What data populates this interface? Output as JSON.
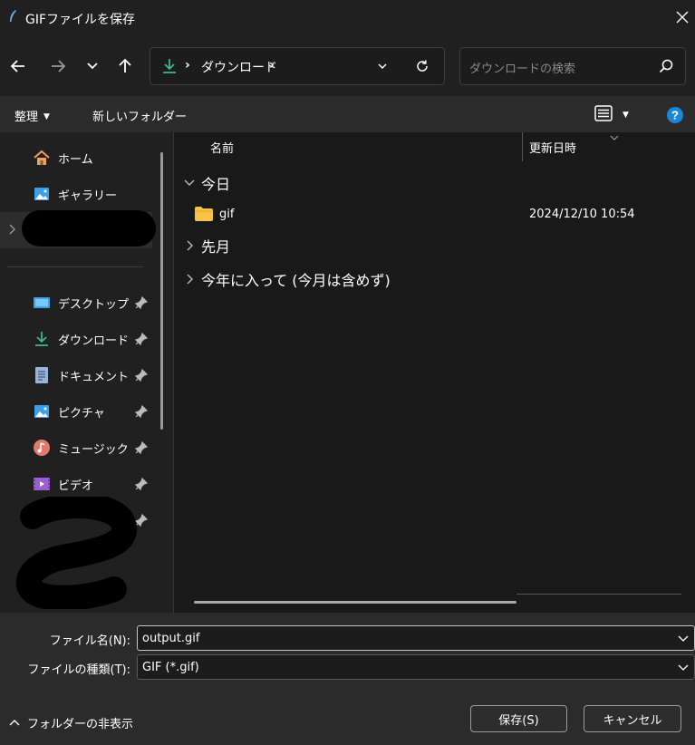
{
  "window": {
    "title": "GIFファイルを保存",
    "close_icon": "close-icon",
    "app_icon": "quill-icon"
  },
  "nav": {
    "back_icon": "arrow-left-icon",
    "forward_icon": "arrow-right-icon",
    "recent_icon": "chevron-down-icon",
    "up_icon": "arrow-up-icon",
    "address": {
      "separator": "›",
      "crumb": "ダウンロード",
      "icon": "download-icon"
    },
    "refresh_icon": "refresh-icon",
    "search": {
      "placeholder": "ダウンロードの検索",
      "icon": "search-icon"
    }
  },
  "commandbar": {
    "organize_label": "整理",
    "new_folder_label": "新しいフォルダー",
    "view_icon": "list-view-icon",
    "help_icon": "help-icon"
  },
  "sidebar": {
    "top_items": [
      {
        "label": "ホーム",
        "icon": "home-icon"
      },
      {
        "label": "ギャラリー",
        "icon": "gallery-icon"
      }
    ],
    "pinned_items": [
      {
        "label": "デスクトップ",
        "icon": "desktop-icon"
      },
      {
        "label": "ダウンロード",
        "icon": "download-icon"
      },
      {
        "label": "ドキュメント",
        "icon": "document-icon"
      },
      {
        "label": "ピクチャ",
        "icon": "pictures-icon"
      },
      {
        "label": "ミュージック",
        "icon": "music-icon"
      },
      {
        "label": "ビデオ",
        "icon": "video-icon"
      }
    ],
    "pin_icon": "pin-icon"
  },
  "content": {
    "columns": {
      "name": "名前",
      "date": "更新日時"
    },
    "groups": [
      {
        "label": "今日",
        "expanded": true
      },
      {
        "label": "先月",
        "expanded": false
      },
      {
        "label": "今年に入って (今月は含めず)",
        "expanded": false
      }
    ],
    "files": [
      {
        "name": "gif",
        "date": "2024/12/10 10:54",
        "icon": "folder-icon"
      }
    ]
  },
  "bottom": {
    "filename_label": "ファイル名(N):",
    "filename_value": "output.gif",
    "filetype_label": "ファイルの種類(T):",
    "filetype_value": "GIF (*.gif)",
    "hide_folders_label": "フォルダーの非表示",
    "save_label": "保存(S)",
    "cancel_label": "キャンセル"
  },
  "colors": {
    "background": "#202020",
    "content_bg": "#191919",
    "bar_bg": "#2b2b2b",
    "download_green": "#3fb58a",
    "help_blue": "#1a86d9",
    "folder_yellow": "#f6c446"
  }
}
